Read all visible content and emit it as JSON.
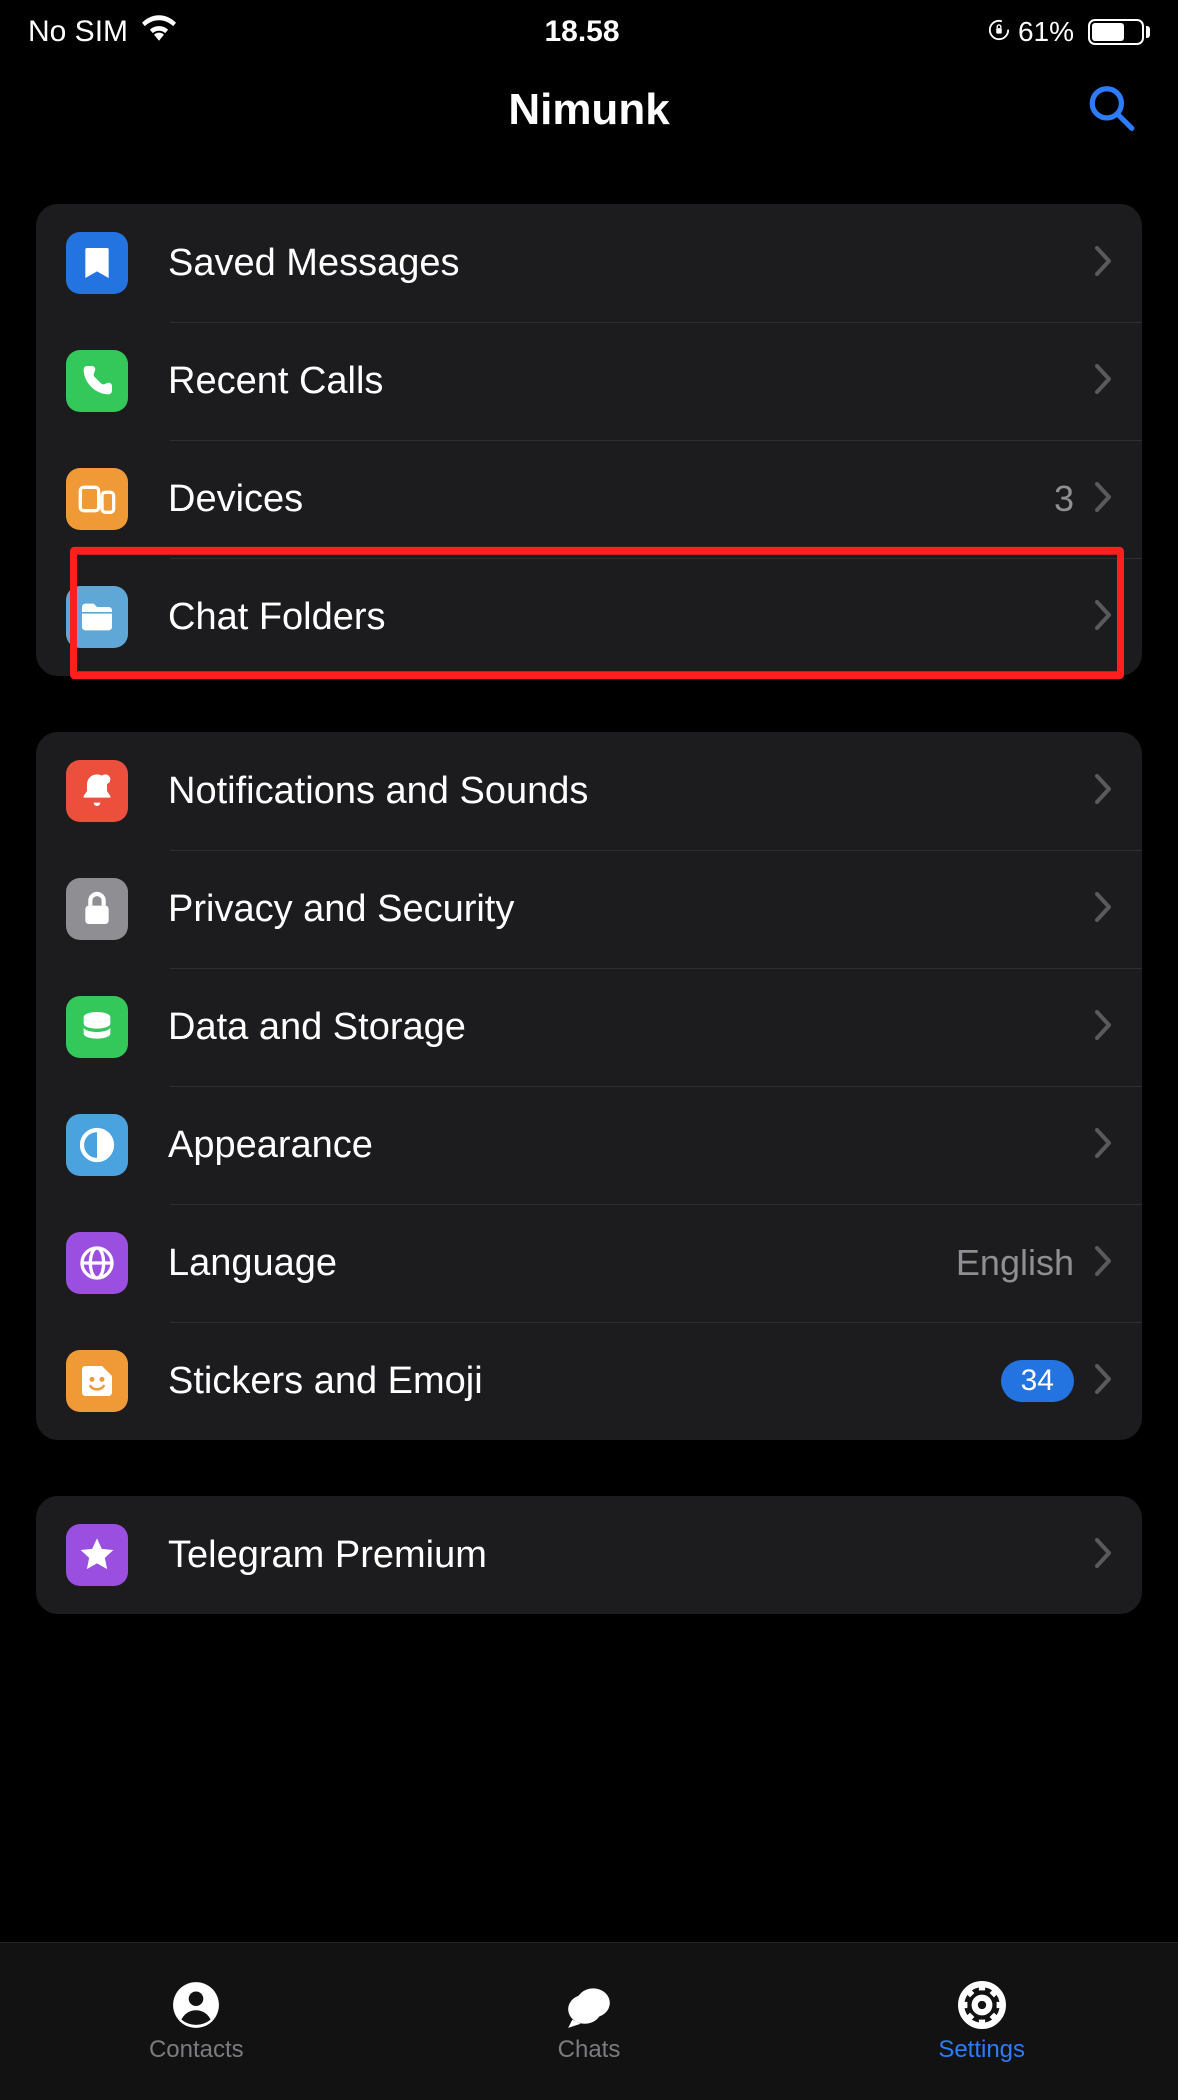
{
  "status": {
    "sim": "No SIM",
    "time": "18.58",
    "battery_pct": "61%"
  },
  "header": {
    "title": "Nimunk"
  },
  "groups": [
    {
      "rows": [
        {
          "id": "saved-messages",
          "label": "Saved Messages",
          "icon": "bookmark",
          "bg": "bg-blue"
        },
        {
          "id": "recent-calls",
          "label": "Recent Calls",
          "icon": "phone",
          "bg": "bg-green"
        },
        {
          "id": "devices",
          "label": "Devices",
          "icon": "devices",
          "bg": "bg-orange",
          "value": "3"
        },
        {
          "id": "chat-folders",
          "label": "Chat Folders",
          "icon": "folder",
          "bg": "bg-lightblue",
          "highlight": true
        }
      ]
    },
    {
      "rows": [
        {
          "id": "notifications",
          "label": "Notifications and Sounds",
          "icon": "bell",
          "bg": "bg-red"
        },
        {
          "id": "privacy",
          "label": "Privacy and Security",
          "icon": "lock",
          "bg": "bg-gray"
        },
        {
          "id": "data",
          "label": "Data and Storage",
          "icon": "stack",
          "bg": "bg-green2"
        },
        {
          "id": "appearance",
          "label": "Appearance",
          "icon": "contrast",
          "bg": "bg-lightblue2"
        },
        {
          "id": "language",
          "label": "Language",
          "icon": "globe",
          "bg": "bg-purple",
          "value": "English"
        },
        {
          "id": "stickers",
          "label": "Stickers and Emoji",
          "icon": "sticker",
          "bg": "bg-orange2",
          "badge": "34"
        }
      ]
    },
    {
      "rows": [
        {
          "id": "premium",
          "label": "Telegram Premium",
          "icon": "star",
          "bg": "bg-purple2"
        }
      ]
    }
  ],
  "tabbar": {
    "items": [
      {
        "id": "contacts",
        "label": "Contacts",
        "icon": "contact"
      },
      {
        "id": "chats",
        "label": "Chats",
        "icon": "chat"
      },
      {
        "id": "settings",
        "label": "Settings",
        "icon": "gear",
        "active": true
      }
    ]
  }
}
